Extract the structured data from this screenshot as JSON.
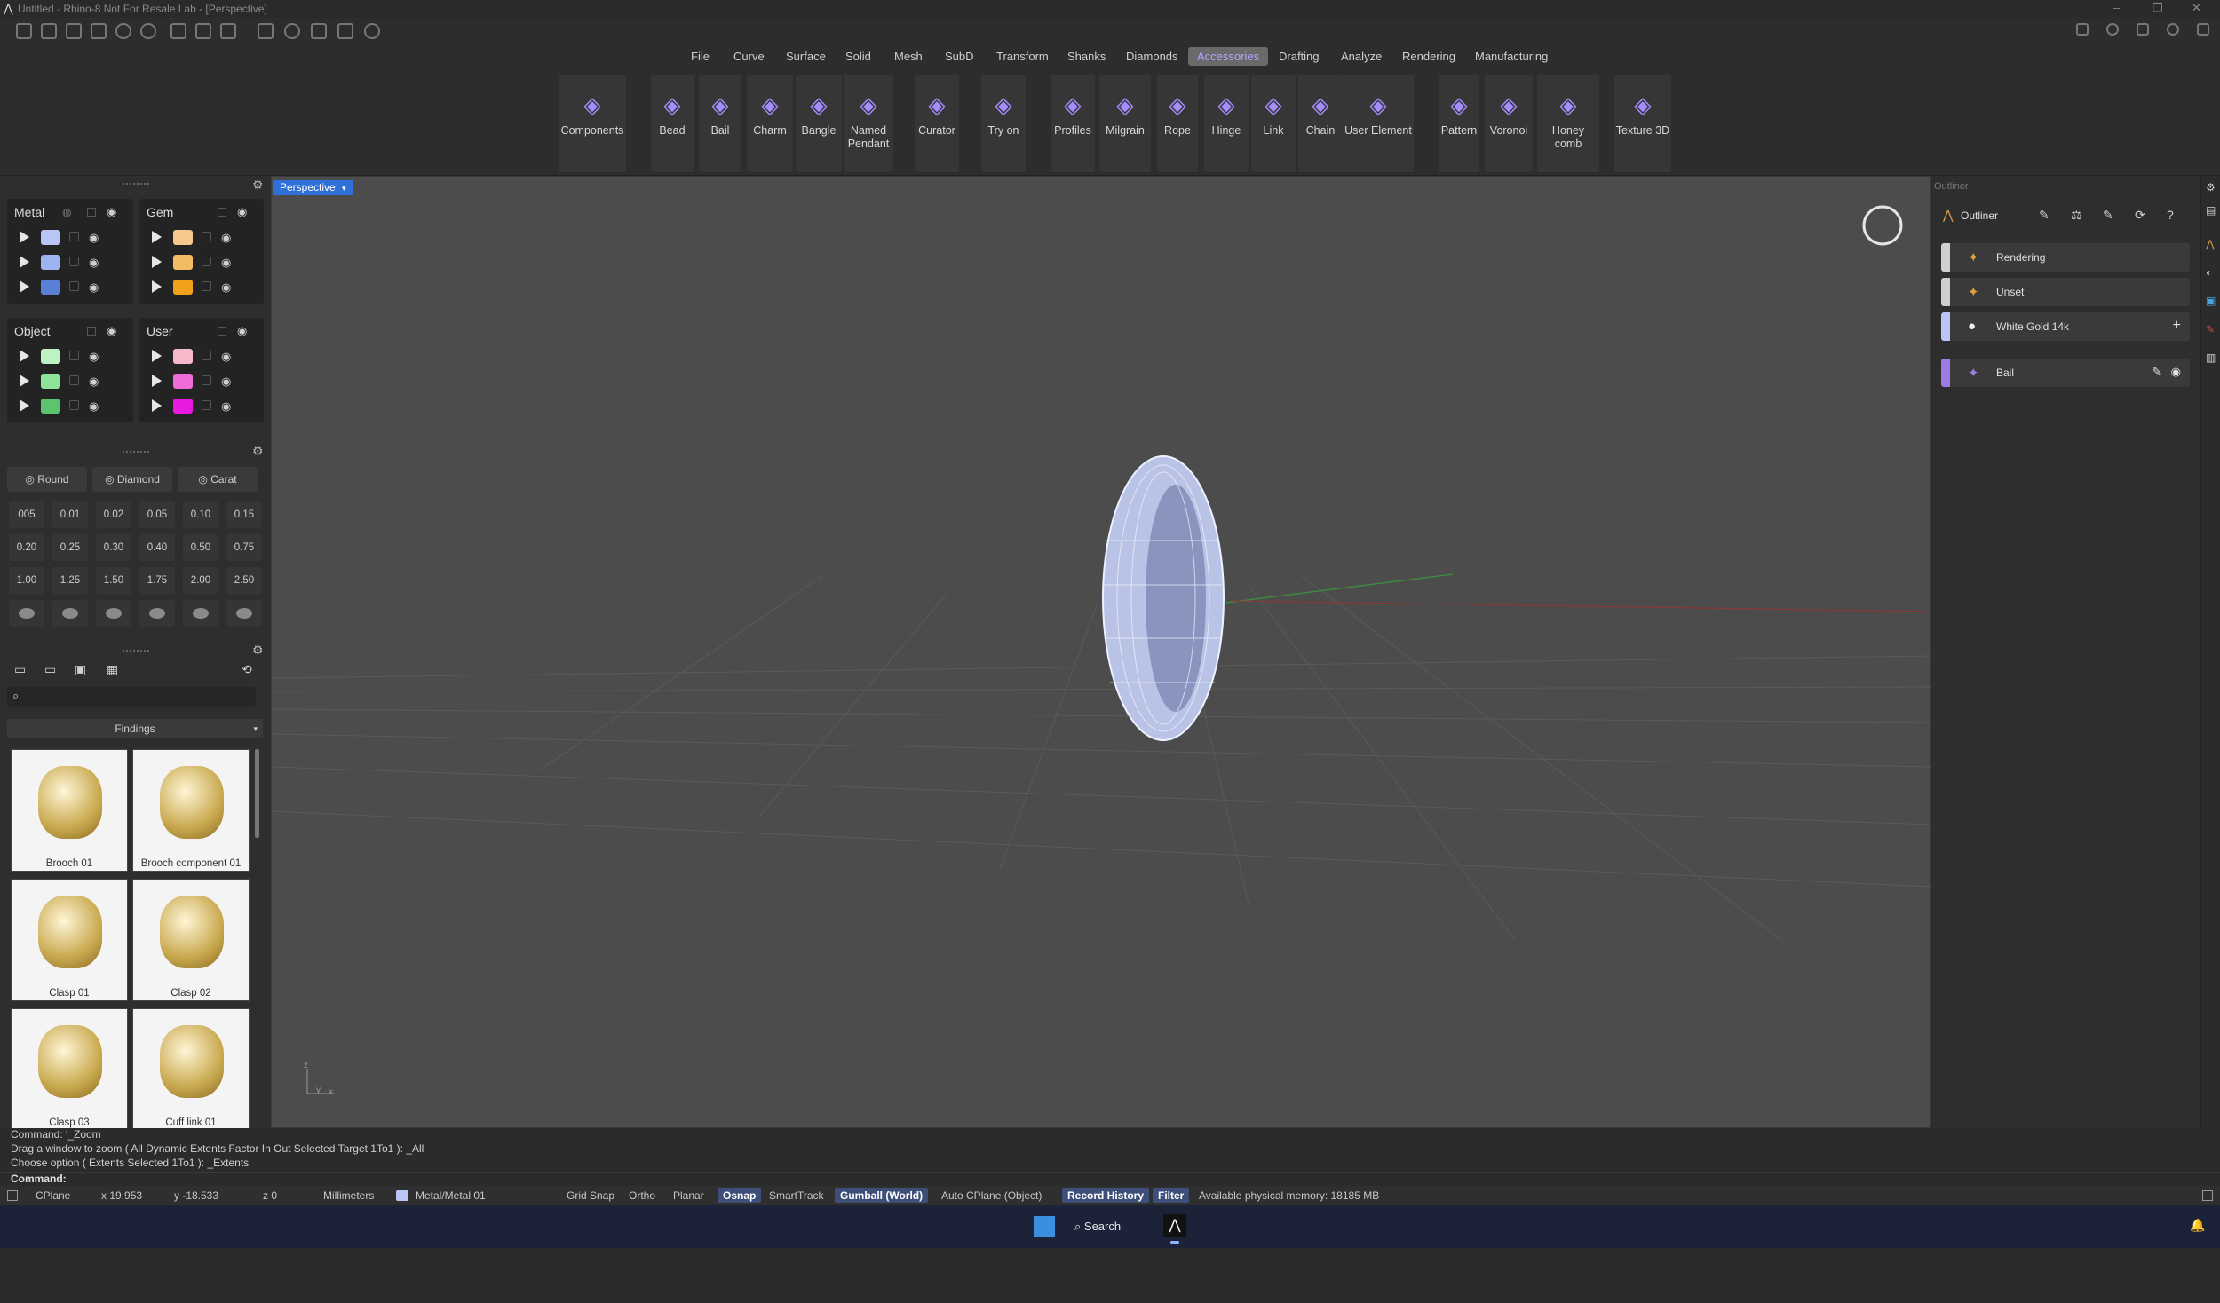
{
  "window": {
    "title": "Untitled - Rhino-8 Not For Resale Lab - [Perspective]"
  },
  "menus": [
    "File",
    "Curve",
    "Surface",
    "Solid",
    "Mesh",
    "SubD",
    "Transform",
    "Shanks",
    "Diamonds",
    "Accessories",
    "Drafting",
    "Analyze",
    "Rendering",
    "Manufacturing"
  ],
  "active_menu": "Accessories",
  "ribbon": [
    {
      "label": "Components",
      "icon": "components-icon"
    },
    {
      "label": "Bead",
      "icon": "bead-icon"
    },
    {
      "label": "Bail",
      "icon": "bail-icon"
    },
    {
      "label": "Charm",
      "icon": "charm-icon"
    },
    {
      "label": "Bangle",
      "icon": "bangle-icon"
    },
    {
      "label": "Named Pendant",
      "icon": "named-pendant-icon"
    },
    {
      "label": "Curator",
      "icon": "curator-icon"
    },
    {
      "label": "Try on",
      "icon": "try-on-icon"
    },
    {
      "label": "Profiles",
      "icon": "profiles-icon"
    },
    {
      "label": "Milgrain",
      "icon": "milgrain-icon"
    },
    {
      "label": "Rope",
      "icon": "rope-icon"
    },
    {
      "label": "Hinge",
      "icon": "hinge-icon"
    },
    {
      "label": "Link",
      "icon": "link-icon"
    },
    {
      "label": "Chain",
      "icon": "chain-icon"
    },
    {
      "label": "User Element",
      "icon": "user-element-icon"
    },
    {
      "label": "Pattern",
      "icon": "pattern-icon"
    },
    {
      "label": "Voronoi",
      "icon": "voronoi-icon"
    },
    {
      "label": "Honey comb",
      "icon": "honeycomb-icon"
    },
    {
      "label": "Texture 3D",
      "icon": "texture-3d-icon"
    }
  ],
  "layers": {
    "metal": {
      "title": "Metal",
      "colors": [
        "#b9c6f5",
        "#9db4ee",
        "#5a7fd6"
      ]
    },
    "gem": {
      "title": "Gem",
      "colors": [
        "#f5c98b",
        "#f3bb63",
        "#f0a21d"
      ]
    },
    "object": {
      "title": "Object",
      "colors": [
        "#bff2c3",
        "#8ee59a",
        "#5dc36f"
      ]
    },
    "user": {
      "title": "User",
      "colors": [
        "#f5b9c9",
        "#ee6bd8",
        "#e81ae0"
      ]
    }
  },
  "gems": {
    "buttons": [
      "Round",
      "Diamond",
      "Carat"
    ],
    "sizes": [
      "005",
      "0.01",
      "0.02",
      "0.05",
      "0.10",
      "0.15",
      "0.20",
      "0.25",
      "0.30",
      "0.40",
      "0.50",
      "0.75",
      "1.00",
      "1.25",
      "1.50",
      "1.75",
      "2.00",
      "2.50"
    ]
  },
  "library": {
    "category": "Findings",
    "items": [
      "Brooch 01",
      "Brooch component 01",
      "Clasp 01",
      "Clasp 02",
      "Clasp 03",
      "Cuff link 01"
    ]
  },
  "viewport": {
    "name": "Perspective"
  },
  "outliner": {
    "panel_title": "Outliner",
    "title": "Outliner",
    "rows": [
      {
        "label": "Rendering",
        "color": "#cfcfcf"
      },
      {
        "label": "Unset",
        "color": "#cfcfcf"
      },
      {
        "label": "White Gold 14k",
        "color": "#b9c6f5"
      },
      {
        "label": "Bail",
        "color": "#9d7be6"
      }
    ]
  },
  "command": {
    "history": [
      "Command: '_Zoom",
      "Drag a window to zoom ( All  Dynamic  Extents  Factor  In  Out  Selected  Target  1To1 ): _All",
      "Choose option ( Extents  Selected  1To1 ): _Extents"
    ],
    "prompt": "Command:"
  },
  "status": {
    "cplane": "CPlane",
    "x": "x 19.953",
    "y": "y -18.533",
    "z": "z 0",
    "units": "Millimeters",
    "layer": "Metal/Metal 01",
    "toggles": [
      {
        "label": "Grid Snap",
        "on": false
      },
      {
        "label": "Ortho",
        "on": false
      },
      {
        "label": "Planar",
        "on": false
      },
      {
        "label": "Osnap",
        "on": true
      },
      {
        "label": "SmartTrack",
        "on": false
      },
      {
        "label": "Gumball (World)",
        "on": true
      },
      {
        "label": "Auto CPlane (Object)",
        "on": false
      },
      {
        "label": "Record History",
        "on": true
      },
      {
        "label": "Filter",
        "on": true
      }
    ],
    "memory": "Available physical memory: 18185 MB"
  },
  "taskbar": {
    "search": "Search"
  }
}
